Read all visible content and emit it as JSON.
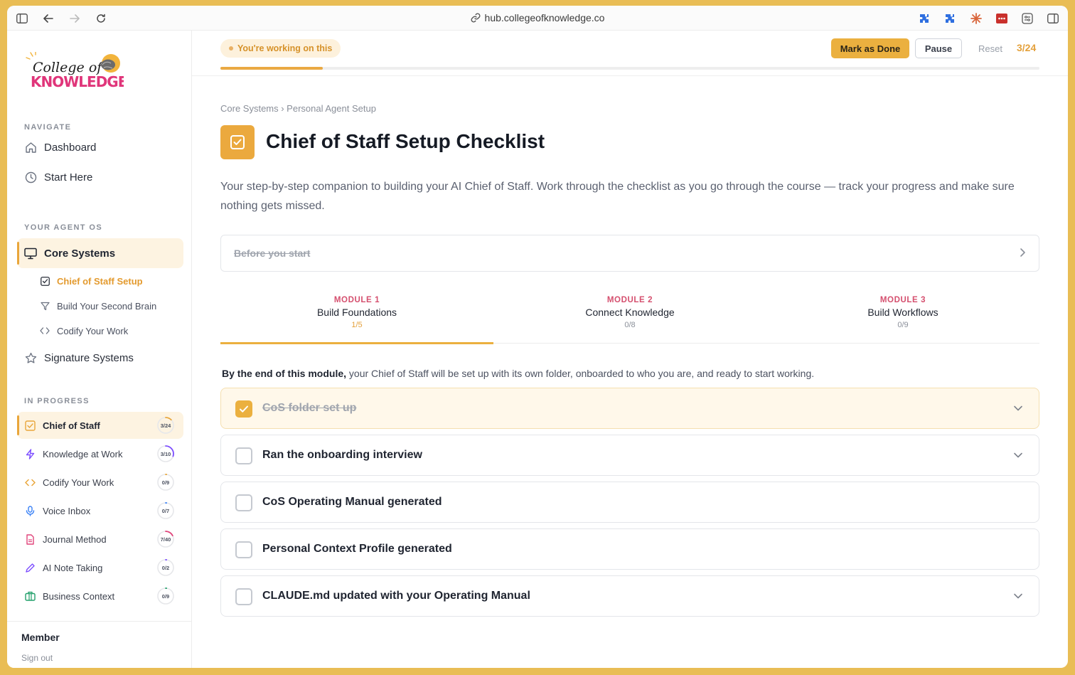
{
  "browser": {
    "url": "hub.collegeofknowledge.co"
  },
  "sidebar": {
    "logo_text": "College of KNOWLEDGE",
    "navigate_label": "NAVIGATE",
    "navigate_items": [
      {
        "label": "Dashboard",
        "icon": "home-icon"
      },
      {
        "label": "Start Here",
        "icon": "clock-icon"
      }
    ],
    "agent_os_label": "YOUR AGENT OS",
    "core_systems": {
      "label": "Core Systems",
      "icon": "monitor-icon"
    },
    "sub_items": [
      {
        "label": "Chief of Staff Setup",
        "icon": "checkbox-icon"
      },
      {
        "label": "Build Your Second Brain",
        "icon": "filter-icon"
      },
      {
        "label": "Codify Your Work",
        "icon": "code-icon"
      }
    ],
    "signature_systems": {
      "label": "Signature Systems",
      "icon": "star-icon"
    },
    "in_progress_label": "IN PROGRESS",
    "progress_items": [
      {
        "label": "Chief of Staff",
        "count": "3/24",
        "fraction": 0.125,
        "color": "#e9a63a",
        "icon": "checkbox-icon"
      },
      {
        "label": "Knowledge at Work",
        "count": "3/10",
        "fraction": 0.3,
        "color": "#7c4dff",
        "icon": "bolt-icon"
      },
      {
        "label": "Codify Your Work",
        "count": "0/9",
        "fraction": 0.0,
        "color": "#e9a63a",
        "icon": "code-icon"
      },
      {
        "label": "Voice Inbox",
        "count": "0/7",
        "fraction": 0.0,
        "color": "#3b82f6",
        "icon": "mic-icon"
      },
      {
        "label": "Journal Method",
        "count": "7/40",
        "fraction": 0.175,
        "color": "#e0457b",
        "icon": "document-icon"
      },
      {
        "label": "AI Note Taking",
        "count": "0/2",
        "fraction": 0.0,
        "color": "#7c4dff",
        "icon": "pen-icon"
      },
      {
        "label": "Business Context",
        "count": "0/9",
        "fraction": 0.0,
        "color": "#22a06b",
        "icon": "briefcase-icon"
      }
    ],
    "member_label": "Member",
    "signout_label": "Sign out"
  },
  "header": {
    "status": "You're working on this",
    "mark_done": "Mark as Done",
    "pause": "Pause",
    "reset": "Reset",
    "counter": "3/24",
    "progress_fraction": 0.125
  },
  "main": {
    "breadcrumb": "Core Systems › Personal Agent Setup",
    "title": "Chief of Staff Setup Checklist",
    "intro": "Your step-by-step companion to building your AI Chief of Staff. Work through the checklist as you go through the course — track your progress and make sure nothing gets missed.",
    "before_start": "Before you start",
    "tabs": [
      {
        "module": "MODULE 1",
        "name": "Build Foundations",
        "count": "1/5"
      },
      {
        "module": "MODULE 2",
        "name": "Connect Knowledge",
        "count": "0/8"
      },
      {
        "module": "MODULE 3",
        "name": "Build Workflows",
        "count": "0/9"
      }
    ],
    "module_desc_bold": "By the end of this module,",
    "module_desc_rest": " your Chief of Staff will be set up with its own folder, onboarded to who you are, and ready to start working.",
    "tasks": [
      {
        "label": "CoS folder set up",
        "done": true,
        "expandable": true
      },
      {
        "label": "Ran the onboarding interview",
        "done": false,
        "expandable": true
      },
      {
        "label": "CoS Operating Manual generated",
        "done": false,
        "expandable": false
      },
      {
        "label": "Personal Context Profile generated",
        "done": false,
        "expandable": false
      },
      {
        "label": "CLAUDE.md updated with your Operating Manual",
        "done": false,
        "expandable": true
      }
    ]
  }
}
